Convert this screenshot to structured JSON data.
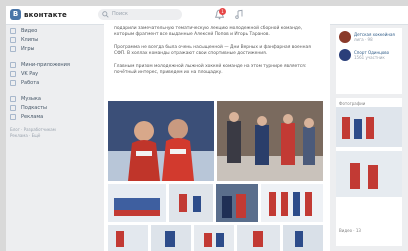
{
  "app": {
    "logo_letter": "В",
    "logo_text": "вконтакте",
    "accent": "#4a76a8"
  },
  "topbar": {
    "search_placeholder": "Поиск",
    "notifications_count": "1"
  },
  "sidebar": {
    "items": [
      {
        "label": "Видео",
        "icon": "video-icon"
      },
      {
        "label": "Клипы",
        "icon": "clips-icon"
      },
      {
        "label": "Игры",
        "icon": "games-icon"
      },
      {
        "label": "Мини-приложения",
        "icon": "apps-icon"
      },
      {
        "label": "VK Pay",
        "icon": "pay-icon"
      },
      {
        "label": "Работа",
        "icon": "work-icon"
      },
      {
        "label": "Музыка",
        "icon": "music-icon"
      },
      {
        "label": "Подкасты",
        "icon": "podcast-icon"
      },
      {
        "label": "Реклама",
        "icon": "ads-icon"
      }
    ],
    "footer": [
      "Блог · Разработчикам",
      "Реклама · Ещё"
    ]
  },
  "post": {
    "paragraph1": "подарили замечательную тематическую лекцию молодежной сборной команде, которым фрагмент все выданные Алексей Попов и Игорь Таранов.",
    "paragraph2": "Программа не всегда была очень насыщенной — Дни Верных и фанфарная военная СФП. В холлах команды отражают свои спортивные достижения.",
    "paragraph3": "Главным призом молодежной лыжной хоккей команде на этом турнире является: почётный интерес, приведем их на площадку."
  },
  "right": {
    "groups": [
      {
        "title": "Детская хоккейная",
        "subtitle": "лига · 98",
        "color": "#8a3a2a"
      },
      {
        "title": "Спорт Одинцово",
        "subtitle": "1561 участник",
        "color": "#2b3f7a"
      }
    ],
    "photos_header": "Фотографии",
    "videos_header": "Видео · 13"
  }
}
